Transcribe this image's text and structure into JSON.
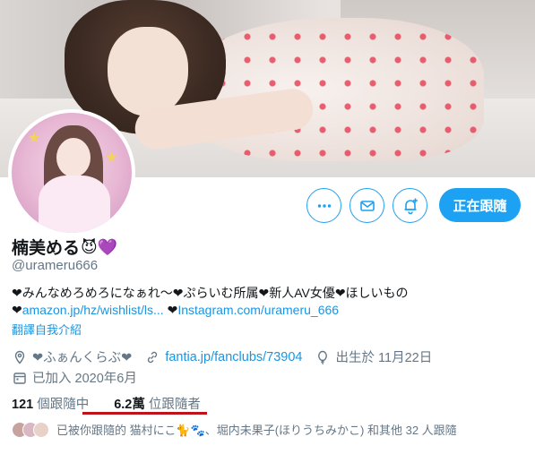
{
  "profile": {
    "name": "楠美める",
    "name_emojis": "😈💜",
    "handle": "@urameru666"
  },
  "actions": {
    "follow_label": "正在跟隨",
    "more_icon": "more-icon",
    "message_icon": "envelope-icon",
    "notify_icon": "bell-plus-icon"
  },
  "bio": {
    "line1": "❤みんなめろめろになぁれ〜❤ぷらいむ所属❤新人AV女優❤ほしいもの",
    "heart_prefix": "❤",
    "wishlist_link": "amazon.jp/hz/wishlist/ls...",
    "heart_mid": " ❤",
    "instagram_link": "Instagram.com/urameru_666",
    "translate": "翻譯自我介紹"
  },
  "meta": {
    "location": "❤ふぁんくらぶ❤",
    "website": "fantia.jp/fanclubs/73904",
    "birthday": "出生於 11月22日",
    "joined": "已加入 2020年6月"
  },
  "stats": {
    "following_count": "121",
    "following_label": "個跟隨中",
    "followers_count": "6.2萬",
    "followers_label": "位跟隨者"
  },
  "followed_by": {
    "text": "已被你跟隨的 猫村にこ🐈🐾、堀内未果子(ほりうちみかこ) 和其他 32 人跟隨"
  },
  "colors": {
    "accent": "#1da1f2",
    "link": "#1b95e0",
    "muted": "#657786",
    "underline": "#c0121b"
  }
}
